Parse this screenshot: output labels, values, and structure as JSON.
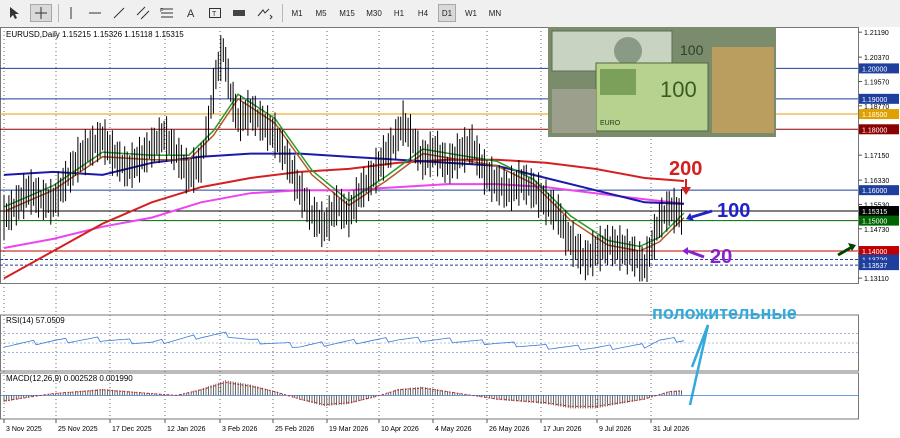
{
  "toolbar": {
    "tools": [
      {
        "name": "cursor-tool-button",
        "icon": "arrow-cursor-icon"
      },
      {
        "name": "crosshair-tool-button",
        "icon": "crosshair-icon"
      },
      {
        "name": "vertical-line-tool-button",
        "icon": "vertical-line-icon"
      },
      {
        "name": "horizontal-line-tool-button",
        "icon": "horizontal-line-icon"
      },
      {
        "name": "trendline-tool-button",
        "icon": "trendline-icon"
      },
      {
        "name": "channel-tool-button",
        "icon": "channel-icon"
      },
      {
        "name": "fibonacci-tool-button",
        "icon": "fibonacci-icon"
      },
      {
        "name": "text-tool-button",
        "icon": "text-icon"
      },
      {
        "name": "label-tool-button",
        "icon": "text-label-icon"
      },
      {
        "name": "rectangle-tool-button",
        "icon": "rectangle-icon"
      },
      {
        "name": "arrows-tool-button",
        "icon": "arrows-icon"
      }
    ],
    "timeframes": [
      "M1",
      "M5",
      "M15",
      "M30",
      "H1",
      "H4",
      "D1",
      "W1",
      "MN"
    ],
    "active_timeframe": "D1"
  },
  "chart_data": {
    "type": "line",
    "symbol_header": "EURUSD,Daily  1.15215 1.15326 1.15118 1.15315",
    "price_ticks": [
      "1.21190",
      "1.20370",
      "1.19570",
      "1.18770",
      "1.17950",
      "1.17150",
      "1.16330",
      "1.15530",
      "1.14730",
      "1.13910",
      "1.13110"
    ],
    "ylim": [
      1.1295,
      1.2136
    ],
    "level_lines": [
      {
        "price": 1.2,
        "label": "1.20000",
        "color": "#1f3f9f"
      },
      {
        "price": 1.19,
        "label": "1.19000",
        "color": "#1f3f9f"
      },
      {
        "price": 1.185,
        "label": "1.18500",
        "color": "#e0a000"
      },
      {
        "price": 1.18,
        "label": "1.18000",
        "color": "#8b0000"
      },
      {
        "price": 1.16,
        "label": "1.16000",
        "color": "#1f3f9f"
      },
      {
        "price": 1.15315,
        "label": "1.15315",
        "color": "#000000"
      },
      {
        "price": 1.15,
        "label": "1.15000",
        "color": "#006400"
      },
      {
        "price": 1.14,
        "label": "1.14000",
        "color": "#c00000"
      },
      {
        "price": 1.1372,
        "label": "1.13720",
        "color": "#1f3f9f"
      },
      {
        "price": 1.13537,
        "label": "1.13537",
        "color": "#1f3f9f"
      }
    ],
    "dates": [
      "3 Nov 2025",
      "25 Nov 2025",
      "17 Dec 2025",
      "12 Jan 2026",
      "3 Feb 2026",
      "25 Feb 2026",
      "19 Mar 2026",
      "10 Apr 2026",
      "4 May 2026",
      "26 May 2026",
      "17 Jun 2026",
      "9 Jul 2026",
      "31 Jul 2026"
    ],
    "ma_periods": [
      "20",
      "100",
      "200"
    ],
    "annotation_positive": "положительные",
    "price_path": [
      [
        0,
        1.151
      ],
      [
        5,
        1.155
      ],
      [
        10,
        1.16
      ],
      [
        15,
        1.157
      ],
      [
        20,
        1.156
      ],
      [
        25,
        1.163
      ],
      [
        30,
        1.17
      ],
      [
        35,
        1.174
      ],
      [
        40,
        1.177
      ],
      [
        45,
        1.171
      ],
      [
        50,
        1.167
      ],
      [
        55,
        1.17
      ],
      [
        60,
        1.174
      ],
      [
        65,
        1.178
      ],
      [
        70,
        1.172
      ],
      [
        75,
        1.165
      ],
      [
        80,
        1.169
      ],
      [
        83,
        1.182
      ],
      [
        86,
        1.198
      ],
      [
        89,
        1.206
      ],
      [
        92,
        1.192
      ],
      [
        95,
        1.183
      ],
      [
        100,
        1.186
      ],
      [
        105,
        1.182
      ],
      [
        110,
        1.178
      ],
      [
        115,
        1.17
      ],
      [
        120,
        1.16
      ],
      [
        125,
        1.152
      ],
      [
        130,
        1.148
      ],
      [
        135,
        1.155
      ],
      [
        140,
        1.152
      ],
      [
        145,
        1.16
      ],
      [
        150,
        1.165
      ],
      [
        155,
        1.172
      ],
      [
        158,
        1.175
      ],
      [
        162,
        1.182
      ],
      [
        166,
        1.176
      ],
      [
        170,
        1.17
      ],
      [
        175,
        1.173
      ],
      [
        180,
        1.168
      ],
      [
        185,
        1.172
      ],
      [
        190,
        1.175
      ],
      [
        195,
        1.166
      ],
      [
        200,
        1.162
      ],
      [
        205,
        1.16
      ],
      [
        210,
        1.163
      ],
      [
        215,
        1.16
      ],
      [
        220,
        1.156
      ],
      [
        225,
        1.152
      ],
      [
        228,
        1.146
      ],
      [
        232,
        1.141
      ],
      [
        236,
        1.137
      ],
      [
        240,
        1.14
      ],
      [
        245,
        1.142
      ],
      [
        250,
        1.141
      ],
      [
        255,
        1.139
      ],
      [
        260,
        1.135
      ],
      [
        263,
        1.142
      ],
      [
        266,
        1.15
      ],
      [
        270,
        1.154
      ],
      [
        274,
        1.1526
      ],
      [
        276,
        1.15315
      ]
    ],
    "ma20_path": [
      [
        0,
        1.153
      ],
      [
        20,
        1.16
      ],
      [
        40,
        1.171
      ],
      [
        60,
        1.17
      ],
      [
        75,
        1.17
      ],
      [
        85,
        1.178
      ],
      [
        95,
        1.19
      ],
      [
        110,
        1.182
      ],
      [
        125,
        1.165
      ],
      [
        140,
        1.155
      ],
      [
        155,
        1.163
      ],
      [
        170,
        1.172
      ],
      [
        185,
        1.17
      ],
      [
        200,
        1.168
      ],
      [
        215,
        1.162
      ],
      [
        230,
        1.15
      ],
      [
        245,
        1.142
      ],
      [
        258,
        1.14
      ],
      [
        266,
        1.143
      ],
      [
        276,
        1.151
      ]
    ],
    "ma100_path": [
      [
        0,
        1.165
      ],
      [
        20,
        1.166
      ],
      [
        40,
        1.165
      ],
      [
        60,
        1.169
      ],
      [
        80,
        1.171
      ],
      [
        100,
        1.172
      ],
      [
        120,
        1.172
      ],
      [
        140,
        1.171
      ],
      [
        160,
        1.17
      ],
      [
        180,
        1.169
      ],
      [
        200,
        1.168
      ],
      [
        220,
        1.164
      ],
      [
        240,
        1.16
      ],
      [
        260,
        1.156
      ],
      [
        276,
        1.1555
      ]
    ],
    "ma200_path": [
      [
        0,
        1.131
      ],
      [
        20,
        1.14
      ],
      [
        40,
        1.149
      ],
      [
        60,
        1.156
      ],
      [
        80,
        1.161
      ],
      [
        100,
        1.164
      ],
      [
        120,
        1.166
      ],
      [
        140,
        1.167
      ],
      [
        160,
        1.169
      ],
      [
        180,
        1.17
      ],
      [
        200,
        1.17
      ],
      [
        220,
        1.169
      ],
      [
        240,
        1.167
      ],
      [
        260,
        1.164
      ],
      [
        276,
        1.163
      ]
    ],
    "ma_pink_path": [
      [
        0,
        1.141
      ],
      [
        20,
        1.144
      ],
      [
        40,
        1.148
      ],
      [
        60,
        1.151
      ],
      [
        80,
        1.156
      ],
      [
        100,
        1.159
      ],
      [
        120,
        1.16
      ],
      [
        140,
        1.16
      ],
      [
        160,
        1.161
      ],
      [
        180,
        1.162
      ],
      [
        200,
        1.162
      ],
      [
        220,
        1.161
      ],
      [
        240,
        1.159
      ],
      [
        260,
        1.157
      ],
      [
        276,
        1.1556
      ]
    ],
    "rsi": {
      "label": "RSI(14) 57.0509",
      "ylim": [
        0,
        100
      ],
      "ticks": [
        "100",
        "70",
        "50.0000",
        "30",
        "0"
      ],
      "levels": [
        70,
        50,
        30
      ],
      "values": [
        [
          0,
          46
        ],
        [
          20,
          54
        ],
        [
          40,
          58
        ],
        [
          60,
          50
        ],
        [
          80,
          64
        ],
        [
          90,
          68
        ],
        [
          100,
          55
        ],
        [
          120,
          44
        ],
        [
          140,
          52
        ],
        [
          160,
          58
        ],
        [
          180,
          56
        ],
        [
          200,
          50
        ],
        [
          220,
          42
        ],
        [
          240,
          40
        ],
        [
          260,
          44
        ],
        [
          266,
          56
        ],
        [
          276,
          57
        ]
      ]
    },
    "macd": {
      "label": "MACD(12,26,9) 0.002528 0.001990",
      "ylim": [
        -0.01,
        0.0085
      ],
      "ticks": [
        "0.007428",
        "0.000000",
        "-0.008862"
      ],
      "hist": [
        [
          0,
          -0.003
        ],
        [
          10,
          -0.001
        ],
        [
          20,
          0.001
        ],
        [
          30,
          0.002
        ],
        [
          40,
          0.003
        ],
        [
          50,
          0.002
        ],
        [
          60,
          0.001
        ],
        [
          70,
          0.0
        ],
        [
          80,
          0.003
        ],
        [
          90,
          0.007
        ],
        [
          100,
          0.005
        ],
        [
          110,
          0.002
        ],
        [
          120,
          -0.002
        ],
        [
          130,
          -0.005
        ],
        [
          140,
          -0.004
        ],
        [
          150,
          -0.001
        ],
        [
          160,
          0.003
        ],
        [
          170,
          0.004
        ],
        [
          180,
          0.002
        ],
        [
          190,
          0.0
        ],
        [
          200,
          -0.002
        ],
        [
          210,
          -0.003
        ],
        [
          220,
          -0.004
        ],
        [
          230,
          -0.006
        ],
        [
          240,
          -0.006
        ],
        [
          250,
          -0.004
        ],
        [
          260,
          -0.002
        ],
        [
          270,
          0.002
        ],
        [
          276,
          0.0025
        ]
      ]
    }
  }
}
